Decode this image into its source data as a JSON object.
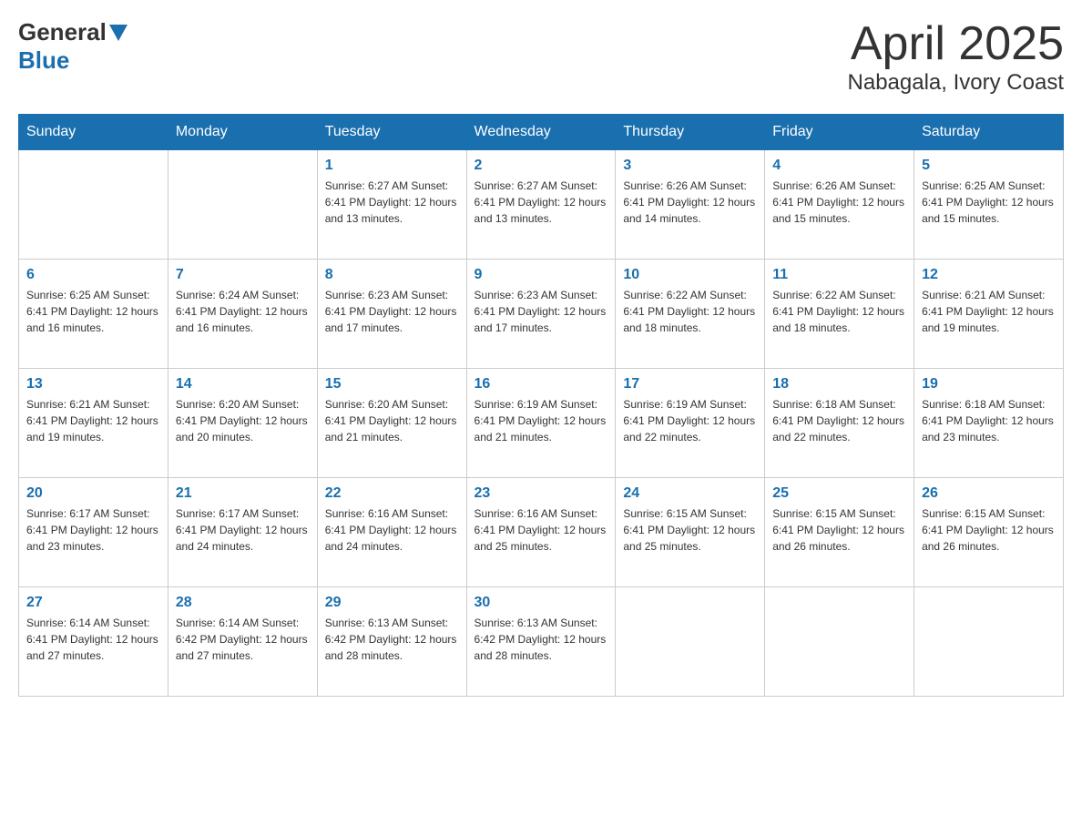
{
  "header": {
    "logo": {
      "part1": "General",
      "part2": "Blue"
    },
    "title": "April 2025",
    "location": "Nabagala, Ivory Coast"
  },
  "weekdays": [
    "Sunday",
    "Monday",
    "Tuesday",
    "Wednesday",
    "Thursday",
    "Friday",
    "Saturday"
  ],
  "weeks": [
    [
      {
        "day": "",
        "info": ""
      },
      {
        "day": "",
        "info": ""
      },
      {
        "day": "1",
        "info": "Sunrise: 6:27 AM\nSunset: 6:41 PM\nDaylight: 12 hours\nand 13 minutes."
      },
      {
        "day": "2",
        "info": "Sunrise: 6:27 AM\nSunset: 6:41 PM\nDaylight: 12 hours\nand 13 minutes."
      },
      {
        "day": "3",
        "info": "Sunrise: 6:26 AM\nSunset: 6:41 PM\nDaylight: 12 hours\nand 14 minutes."
      },
      {
        "day": "4",
        "info": "Sunrise: 6:26 AM\nSunset: 6:41 PM\nDaylight: 12 hours\nand 15 minutes."
      },
      {
        "day": "5",
        "info": "Sunrise: 6:25 AM\nSunset: 6:41 PM\nDaylight: 12 hours\nand 15 minutes."
      }
    ],
    [
      {
        "day": "6",
        "info": "Sunrise: 6:25 AM\nSunset: 6:41 PM\nDaylight: 12 hours\nand 16 minutes."
      },
      {
        "day": "7",
        "info": "Sunrise: 6:24 AM\nSunset: 6:41 PM\nDaylight: 12 hours\nand 16 minutes."
      },
      {
        "day": "8",
        "info": "Sunrise: 6:23 AM\nSunset: 6:41 PM\nDaylight: 12 hours\nand 17 minutes."
      },
      {
        "day": "9",
        "info": "Sunrise: 6:23 AM\nSunset: 6:41 PM\nDaylight: 12 hours\nand 17 minutes."
      },
      {
        "day": "10",
        "info": "Sunrise: 6:22 AM\nSunset: 6:41 PM\nDaylight: 12 hours\nand 18 minutes."
      },
      {
        "day": "11",
        "info": "Sunrise: 6:22 AM\nSunset: 6:41 PM\nDaylight: 12 hours\nand 18 minutes."
      },
      {
        "day": "12",
        "info": "Sunrise: 6:21 AM\nSunset: 6:41 PM\nDaylight: 12 hours\nand 19 minutes."
      }
    ],
    [
      {
        "day": "13",
        "info": "Sunrise: 6:21 AM\nSunset: 6:41 PM\nDaylight: 12 hours\nand 19 minutes."
      },
      {
        "day": "14",
        "info": "Sunrise: 6:20 AM\nSunset: 6:41 PM\nDaylight: 12 hours\nand 20 minutes."
      },
      {
        "day": "15",
        "info": "Sunrise: 6:20 AM\nSunset: 6:41 PM\nDaylight: 12 hours\nand 21 minutes."
      },
      {
        "day": "16",
        "info": "Sunrise: 6:19 AM\nSunset: 6:41 PM\nDaylight: 12 hours\nand 21 minutes."
      },
      {
        "day": "17",
        "info": "Sunrise: 6:19 AM\nSunset: 6:41 PM\nDaylight: 12 hours\nand 22 minutes."
      },
      {
        "day": "18",
        "info": "Sunrise: 6:18 AM\nSunset: 6:41 PM\nDaylight: 12 hours\nand 22 minutes."
      },
      {
        "day": "19",
        "info": "Sunrise: 6:18 AM\nSunset: 6:41 PM\nDaylight: 12 hours\nand 23 minutes."
      }
    ],
    [
      {
        "day": "20",
        "info": "Sunrise: 6:17 AM\nSunset: 6:41 PM\nDaylight: 12 hours\nand 23 minutes."
      },
      {
        "day": "21",
        "info": "Sunrise: 6:17 AM\nSunset: 6:41 PM\nDaylight: 12 hours\nand 24 minutes."
      },
      {
        "day": "22",
        "info": "Sunrise: 6:16 AM\nSunset: 6:41 PM\nDaylight: 12 hours\nand 24 minutes."
      },
      {
        "day": "23",
        "info": "Sunrise: 6:16 AM\nSunset: 6:41 PM\nDaylight: 12 hours\nand 25 minutes."
      },
      {
        "day": "24",
        "info": "Sunrise: 6:15 AM\nSunset: 6:41 PM\nDaylight: 12 hours\nand 25 minutes."
      },
      {
        "day": "25",
        "info": "Sunrise: 6:15 AM\nSunset: 6:41 PM\nDaylight: 12 hours\nand 26 minutes."
      },
      {
        "day": "26",
        "info": "Sunrise: 6:15 AM\nSunset: 6:41 PM\nDaylight: 12 hours\nand 26 minutes."
      }
    ],
    [
      {
        "day": "27",
        "info": "Sunrise: 6:14 AM\nSunset: 6:41 PM\nDaylight: 12 hours\nand 27 minutes."
      },
      {
        "day": "28",
        "info": "Sunrise: 6:14 AM\nSunset: 6:42 PM\nDaylight: 12 hours\nand 27 minutes."
      },
      {
        "day": "29",
        "info": "Sunrise: 6:13 AM\nSunset: 6:42 PM\nDaylight: 12 hours\nand 28 minutes."
      },
      {
        "day": "30",
        "info": "Sunrise: 6:13 AM\nSunset: 6:42 PM\nDaylight: 12 hours\nand 28 minutes."
      },
      {
        "day": "",
        "info": ""
      },
      {
        "day": "",
        "info": ""
      },
      {
        "day": "",
        "info": ""
      }
    ]
  ]
}
